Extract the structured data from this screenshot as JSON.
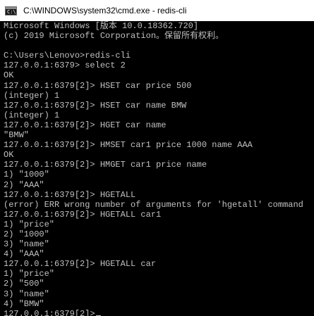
{
  "window": {
    "title": "C:\\WINDOWS\\system32\\cmd.exe - redis-cli",
    "icon": "cmd-console-icon",
    "icon_glyph": "C:\\",
    "colors": {
      "titlebar": "#ffffff",
      "console_background": "#000000",
      "console_text": "#c0c0c0"
    }
  },
  "console": {
    "lines": [
      "Microsoft Windows [版本 10.0.18362.720]",
      "(c) 2019 Microsoft Corporation。保留所有权利。",
      "",
      "C:\\Users\\Lenovo>redis-cli",
      "127.0.0.1:6379> select 2",
      "OK",
      "127.0.0.1:6379[2]> HSET car price 500",
      "(integer) 1",
      "127.0.0.1:6379[2]> HSET car name BMW",
      "(integer) 1",
      "127.0.0.1:6379[2]> HGET car name",
      "\"BMW\"",
      "127.0.0.1:6379[2]> HMSET car1 price 1000 name AAA",
      "OK",
      "127.0.0.1:6379[2]> HMGET car1 price name",
      "1) \"1000\"",
      "2) \"AAA\"",
      "127.0.0.1:6379[2]> HGETALL",
      "(error) ERR wrong number of arguments for 'hgetall' command",
      "127.0.0.1:6379[2]> HGETALL car1",
      "1) \"price\"",
      "2) \"1000\"",
      "3) \"name\"",
      "4) \"AAA\"",
      "127.0.0.1:6379[2]> HGETALL car",
      "1) \"price\"",
      "2) \"500\"",
      "3) \"name\"",
      "4) \"BMW\""
    ],
    "prompt": "127.0.0.1:6379[2]>"
  }
}
